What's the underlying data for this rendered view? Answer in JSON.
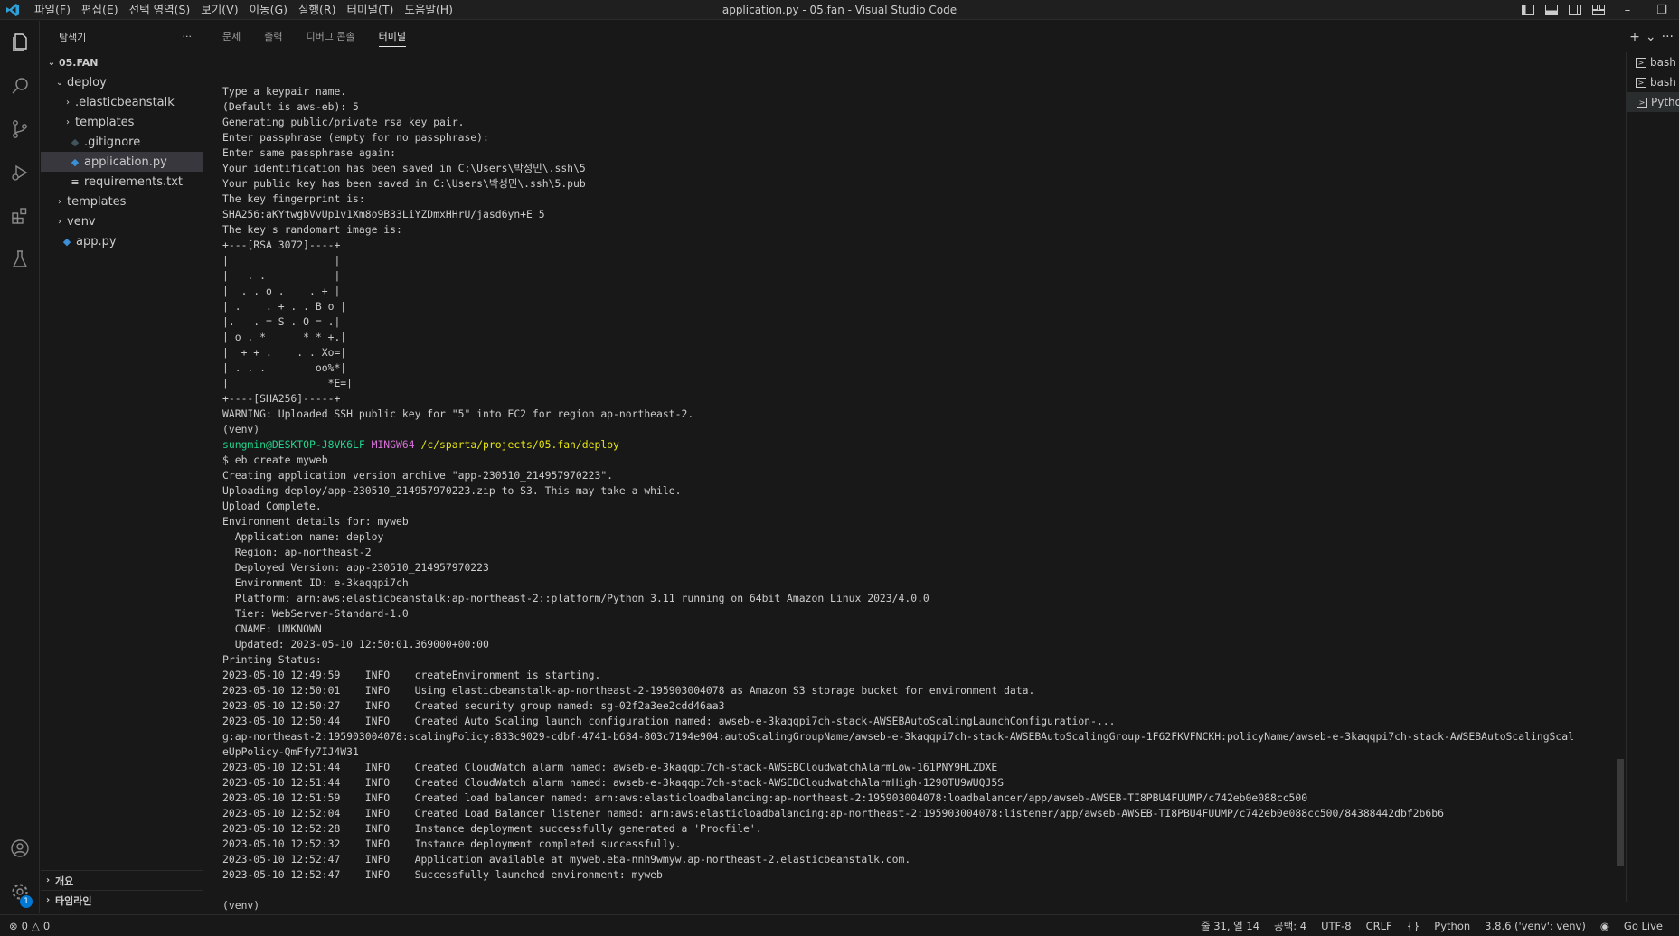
{
  "titlebar": {
    "menu": [
      "파일(F)",
      "편집(E)",
      "선택 영역(S)",
      "보기(V)",
      "이동(G)",
      "실행(R)",
      "터미널(T)",
      "도움말(H)"
    ],
    "title": "application.py - 05.fan - Visual Studio Code"
  },
  "sidebar": {
    "header": "탐색기",
    "more": "···",
    "root": "05.FAN",
    "tree": [
      {
        "label": "deploy",
        "type": "folder-open",
        "depth": 1
      },
      {
        "label": ".elasticbeanstalk",
        "type": "folder",
        "depth": 2
      },
      {
        "label": "templates",
        "type": "folder",
        "depth": 2
      },
      {
        "label": ".gitignore",
        "type": "git",
        "depth": 2
      },
      {
        "label": "application.py",
        "type": "python",
        "depth": 2,
        "selected": true
      },
      {
        "label": "requirements.txt",
        "type": "text",
        "depth": 2
      },
      {
        "label": "templates",
        "type": "folder",
        "depth": 1
      },
      {
        "label": "venv",
        "type": "folder",
        "depth": 1
      },
      {
        "label": "app.py",
        "type": "python",
        "depth": 1
      }
    ],
    "outline": "개요",
    "timeline": "타임라인"
  },
  "panel": {
    "tabs": [
      "문제",
      "출력",
      "디버그 콘솔",
      "터미널"
    ],
    "active_tab": 3,
    "actions": {
      "add": "+",
      "dropdown": "⌄",
      "more": "···"
    }
  },
  "terminal_lines": [
    {
      "t": "Type a keypair name."
    },
    {
      "t": "(Default is aws-eb): 5"
    },
    {
      "t": "Generating public/private rsa key pair."
    },
    {
      "t": "Enter passphrase (empty for no passphrase):"
    },
    {
      "t": "Enter same passphrase again:"
    },
    {
      "t": "Your identification has been saved in C:\\Users\\박성민\\.ssh\\5"
    },
    {
      "t": "Your public key has been saved in C:\\Users\\박성민\\.ssh\\5.pub"
    },
    {
      "t": "The key fingerprint is:"
    },
    {
      "t": "SHA256:aKYtwgbVvUp1v1Xm8o9B33LiYZDmxHHrU/jasd6yn+E 5"
    },
    {
      "t": "The key's randomart image is:"
    },
    {
      "t": "+---[RSA 3072]----+"
    },
    {
      "t": "|                 |"
    },
    {
      "t": "|   . .           |"
    },
    {
      "t": "|  . . o .    . + |"
    },
    {
      "t": "| .    . + . . B o |"
    },
    {
      "t": "|.   . = S . O = .|"
    },
    {
      "t": "| o . *      * * +.|"
    },
    {
      "t": "|  + + .    . . Xo=|"
    },
    {
      "t": "| . . .        oo%*|"
    },
    {
      "t": "|                *E=|"
    },
    {
      "t": "+----[SHA256]-----+"
    },
    {
      "t": "WARNING: Uploaded SSH public key for \"5\" into EC2 for region ap-northeast-2."
    },
    {
      "t": "(venv)"
    },
    {
      "prompt": true,
      "user": "sungmin@DESKTOP-J8VK6LF",
      "shell": "MINGW64",
      "path": "/c/sparta/projects/05.fan/deploy"
    },
    {
      "t": "$ eb create myweb"
    },
    {
      "t": "Creating application version archive \"app-230510_214957970223\"."
    },
    {
      "t": "Uploading deploy/app-230510_214957970223.zip to S3. This may take a while."
    },
    {
      "t": "Upload Complete."
    },
    {
      "t": "Environment details for: myweb"
    },
    {
      "t": "  Application name: deploy"
    },
    {
      "t": "  Region: ap-northeast-2"
    },
    {
      "t": "  Deployed Version: app-230510_214957970223"
    },
    {
      "t": "  Environment ID: e-3kaqqpi7ch"
    },
    {
      "t": "  Platform: arn:aws:elasticbeanstalk:ap-northeast-2::platform/Python 3.11 running on 64bit Amazon Linux 2023/4.0.0"
    },
    {
      "t": "  Tier: WebServer-Standard-1.0"
    },
    {
      "t": "  CNAME: UNKNOWN"
    },
    {
      "t": "  Updated: 2023-05-10 12:50:01.369000+00:00"
    },
    {
      "t": "Printing Status:"
    },
    {
      "t": "2023-05-10 12:49:59    INFO    createEnvironment is starting."
    },
    {
      "t": "2023-05-10 12:50:01    INFO    Using elasticbeanstalk-ap-northeast-2-195903004078 as Amazon S3 storage bucket for environment data."
    },
    {
      "t": "2023-05-10 12:50:27    INFO    Created security group named: sg-02f2a3ee2cdd46aa3"
    },
    {
      "t": "2023-05-10 12:50:44    INFO    Created Auto Scaling launch configuration named: awseb-e-3kaqqpi7ch-stack-AWSEBAutoScalingLaunchConfiguration-..."
    },
    {
      "t": "g:ap-northeast-2:195903004078:scalingPolicy:833c9029-cdbf-4741-b684-803c7194e904:autoScalingGroupName/awseb-e-3kaqqpi7ch-stack-AWSEBAutoScalingGroup-1F62FKVFNCKH:policyName/awseb-e-3kaqqpi7ch-stack-AWSEBAutoScalingScal"
    },
    {
      "t": "eUpPolicy-QmFfy7IJ4W31"
    },
    {
      "t": "2023-05-10 12:51:44    INFO    Created CloudWatch alarm named: awseb-e-3kaqqpi7ch-stack-AWSEBCloudwatchAlarmLow-161PNY9HLZDXE"
    },
    {
      "t": "2023-05-10 12:51:44    INFO    Created CloudWatch alarm named: awseb-e-3kaqqpi7ch-stack-AWSEBCloudwatchAlarmHigh-1290TU9WUQJ5S"
    },
    {
      "t": "2023-05-10 12:51:59    INFO    Created load balancer named: arn:aws:elasticloadbalancing:ap-northeast-2:195903004078:loadbalancer/app/awseb-AWSEB-TI8PBU4FUUMP/c742eb0e088cc500"
    },
    {
      "t": "2023-05-10 12:52:04    INFO    Created Load Balancer listener named: arn:aws:elasticloadbalancing:ap-northeast-2:195903004078:listener/app/awseb-AWSEB-TI8PBU4FUUMP/c742eb0e088cc500/84388442dbf2b6b6"
    },
    {
      "t": "2023-05-10 12:52:28    INFO    Instance deployment successfully generated a 'Procfile'."
    },
    {
      "t": "2023-05-10 12:52:32    INFO    Instance deployment completed successfully."
    },
    {
      "t": "2023-05-10 12:52:47    INFO    Application available at myweb.eba-nnh9wmyw.ap-northeast-2.elasticbeanstalk.com."
    },
    {
      "t": "2023-05-10 12:52:47    INFO    Successfully launched environment: myweb"
    },
    {
      "t": ""
    },
    {
      "t": "(venv)"
    },
    {
      "prompt": true,
      "user": "sungmin@DESKTOP-J8VK6LF",
      "shell": "MINGW64",
      "path": "/c/sparta/projects/05.fan/deploy"
    }
  ],
  "terminal_list": [
    {
      "label": "bash",
      "active": false
    },
    {
      "label": "bash",
      "active": false
    },
    {
      "label": "Python",
      "active": true
    }
  ],
  "statusbar": {
    "errors": "0",
    "warnings": "0",
    "cursor": "줄 31, 열 14",
    "spaces": "공백: 4",
    "encoding": "UTF-8",
    "eol": "CRLF",
    "language": "Python",
    "interpreter": "3.8.6 ('venv': venv)",
    "golive": "Go Live"
  },
  "settings_badge": "1",
  "colors": {
    "accent": "#0078d4",
    "prompt_user": "#23d18b",
    "prompt_shell": "#d670d6",
    "prompt_path": "#e5e510"
  }
}
